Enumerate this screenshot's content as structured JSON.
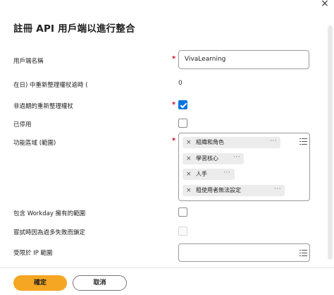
{
  "dialog": {
    "title": "註冊 API 用戶端以進行整合",
    "close_label": "×"
  },
  "fields": {
    "client_name_label": "用戶端名稱",
    "client_name_value": "VivaLearning",
    "refresh_token_label": "在日) 中重新整理權杖逾時 (",
    "refresh_token_value": "0",
    "non_expiring_label": "非過期的重新整理權杖",
    "disabled_label": "已停用",
    "scope_label": "功能區域 (範圍)",
    "include_workday_label": "包含 Workday 擁有的範圍",
    "lock_on_failure_label": "嘗試時因為過多失敗而鎖定",
    "restricted_ip_label": "受限於 IP 範圍",
    "required_mark": "*"
  },
  "scopes": [
    {
      "label": "組織和角色",
      "remove": "×",
      "more": "···"
    },
    {
      "label": "學習核心",
      "remove": "×",
      "more": "···"
    },
    {
      "label": "人手",
      "remove": "×",
      "more": "···"
    },
    {
      "label": "租使用者無法設定",
      "remove": "×",
      "more": "···"
    }
  ],
  "state": {
    "non_expiring_checked": true,
    "disabled_checked": false,
    "include_workday_checked": false,
    "lock_on_failure_disabled": true
  },
  "icons": {
    "close": "close-icon",
    "list": "list-prompt-icon",
    "remove": "remove-icon",
    "more": "more-icon"
  },
  "footer": {
    "ok_label": "確定",
    "cancel_label": "取消"
  },
  "colors": {
    "primary_button": "#f5a623",
    "checkbox_checked": "#0875e1",
    "required": "#c8102e"
  }
}
